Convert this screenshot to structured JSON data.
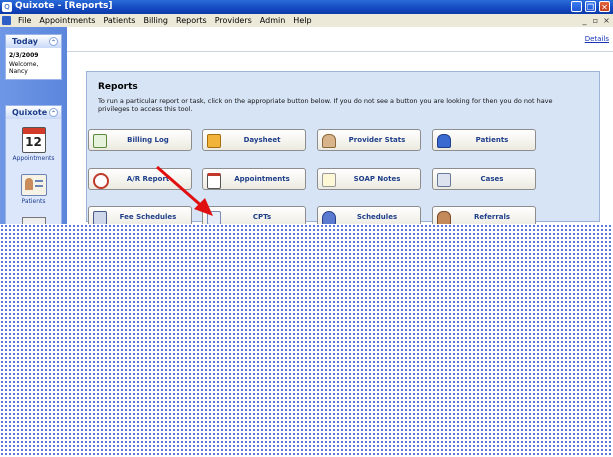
{
  "window": {
    "title": "Quixote - [Reports]"
  },
  "menu": {
    "items": [
      "File",
      "Appointments",
      "Patients",
      "Billing",
      "Reports",
      "Providers",
      "Admin",
      "Help"
    ]
  },
  "sidebar": {
    "today": {
      "title": "Today",
      "date": "2/3/2009",
      "welcome": "Welcome,",
      "user": "Nancy"
    },
    "quixote": {
      "title": "Quixote",
      "calendar_number": "12",
      "items": [
        "Appointments",
        "Patients"
      ]
    }
  },
  "main": {
    "details_link": "Details",
    "reports": {
      "title": "Reports",
      "description": "To run a particular report or task, click on the appropriate button below.  If you do not see a button you are looking for then you do not have privileges to access this tool.",
      "buttons": [
        "Billing Log",
        "Daysheet",
        "Provider Stats",
        "Patients",
        "A/R Report",
        "Appointments",
        "SOAP Notes",
        "Cases",
        "Fee Schedules",
        "CPTs",
        "Schedules",
        "Referrals"
      ]
    }
  },
  "colors": {
    "accent": "#1f3f8a",
    "arrow": "#e01010",
    "panel": "#d6e4f6"
  }
}
